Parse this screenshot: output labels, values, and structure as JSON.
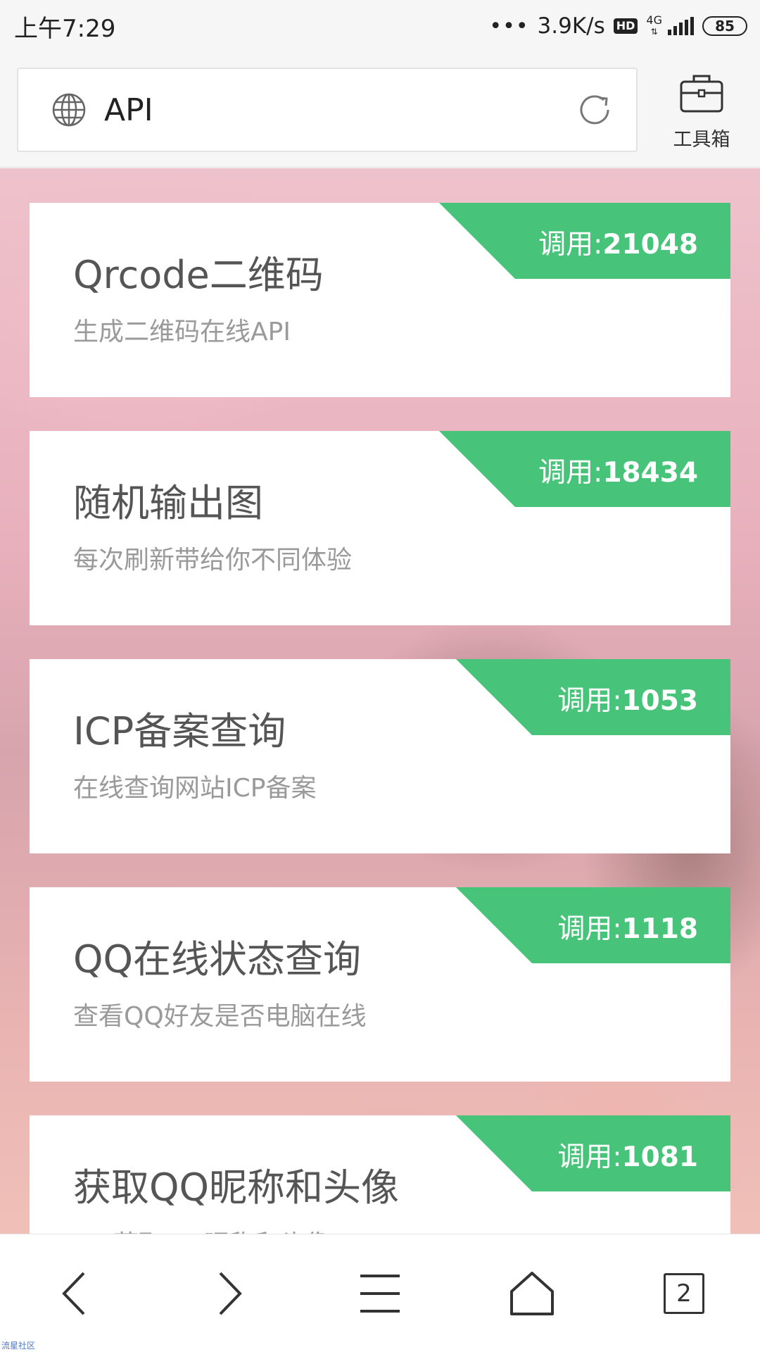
{
  "status_bar": {
    "time": "上午7:29",
    "speed": "3.9K/s",
    "hd": "HD",
    "network": "4G",
    "battery": "85"
  },
  "address_bar": {
    "url_text": "API",
    "icon": "globe-icon",
    "refresh_icon": "refresh-icon"
  },
  "toolbox": {
    "label": "工具箱",
    "icon": "toolbox-icon"
  },
  "ribbon_prefix": "调用:",
  "cards": [
    {
      "title": "Qrcode二维码",
      "desc": "生成二维码在线API",
      "calls": "21048"
    },
    {
      "title": "随机输出图",
      "desc": "每次刷新带给你不同体验",
      "calls": "18434"
    },
    {
      "title": "ICP备案查询",
      "desc": "在线查询网站ICP备案",
      "calls": "1053"
    },
    {
      "title": "QQ在线状态查询",
      "desc": "查看QQ好友是否电脑在线",
      "calls": "1118"
    },
    {
      "title": "获取QQ昵称和头像",
      "desc": "API获取QQ昵称和头像",
      "calls": "1081"
    }
  ],
  "bottom_nav": {
    "back_icon": "back-icon",
    "forward_icon": "forward-icon",
    "menu_icon": "menu-icon",
    "home_icon": "home-icon",
    "tab_count": "2"
  },
  "watermark": "流星社区",
  "colors": {
    "accent_green": "#47c479",
    "card_bg": "#ffffff",
    "title_text": "#555555",
    "desc_text": "#9a9a9a"
  }
}
